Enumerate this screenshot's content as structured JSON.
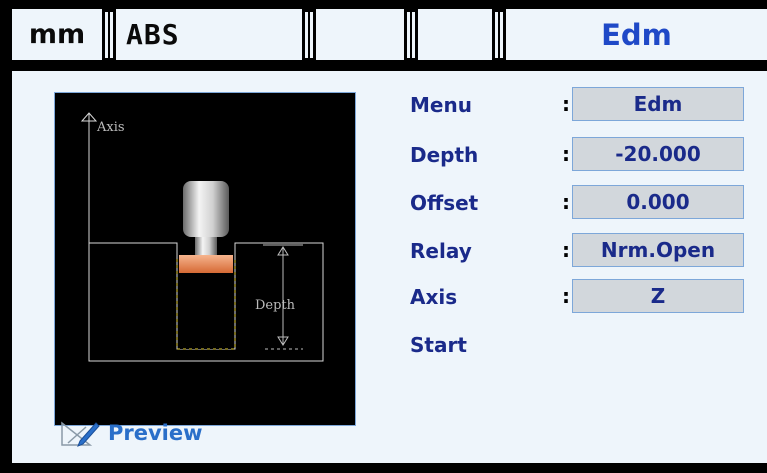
{
  "header": {
    "unit": "mm",
    "mode": "ABS",
    "empty_tab_1": "",
    "empty_tab_2": "",
    "function": "Edm"
  },
  "diagram": {
    "axis_label": "Axis",
    "depth_label": "Depth"
  },
  "params": [
    {
      "name": "Menu",
      "value": "Edm"
    },
    {
      "name": "Depth",
      "value": "-20.000"
    },
    {
      "name": "Offset",
      "value": "0.000"
    },
    {
      "name": "Relay",
      "value": "Nrm.Open"
    },
    {
      "name": "Axis",
      "value": "Z"
    },
    {
      "name": "Start"
    }
  ],
  "colon": ":",
  "preview": {
    "label": "Preview",
    "icon": "preview-pencil-icon"
  },
  "colors": {
    "background": "#eef5fb",
    "accent_blue": "#1f49c7",
    "label_navy": "#1a2a8a",
    "field_gray": "#d2d7dc",
    "electrode_copper": "#e8895a"
  }
}
